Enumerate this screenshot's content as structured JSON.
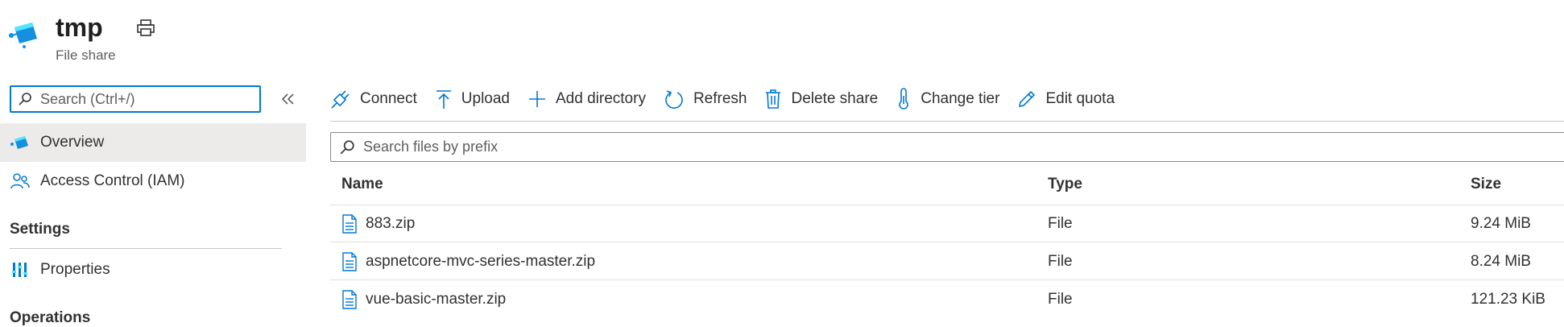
{
  "header": {
    "title": "tmp",
    "subtitle": "File share"
  },
  "sidebar": {
    "search": {
      "placeholder": "Search (Ctrl+/)"
    },
    "items": [
      {
        "label": "Overview",
        "icon": "file-share-icon",
        "selected": true
      },
      {
        "label": "Access Control (IAM)",
        "icon": "people-icon",
        "selected": false
      }
    ],
    "sections": [
      {
        "title": "Settings",
        "items": [
          {
            "label": "Properties",
            "icon": "properties-icon"
          }
        ]
      },
      {
        "title": "Operations",
        "items": []
      }
    ]
  },
  "toolbar": {
    "connect": "Connect",
    "upload": "Upload",
    "add_directory": "Add directory",
    "refresh": "Refresh",
    "delete_share": "Delete share",
    "change_tier": "Change tier",
    "edit_quota": "Edit quota"
  },
  "files": {
    "search_placeholder": "Search files by prefix",
    "columns": {
      "name": "Name",
      "type": "Type",
      "size": "Size"
    },
    "rows": [
      {
        "name": "883.zip",
        "type": "File",
        "size": "9.24 MiB"
      },
      {
        "name": "aspnetcore-mvc-series-master.zip",
        "type": "File",
        "size": "8.24 MiB"
      },
      {
        "name": "vue-basic-master.zip",
        "type": "File",
        "size": "121.23 KiB"
      }
    ]
  },
  "colors": {
    "accent": "#0078d4",
    "selected_bg": "#edebe9",
    "text": "#323130"
  }
}
